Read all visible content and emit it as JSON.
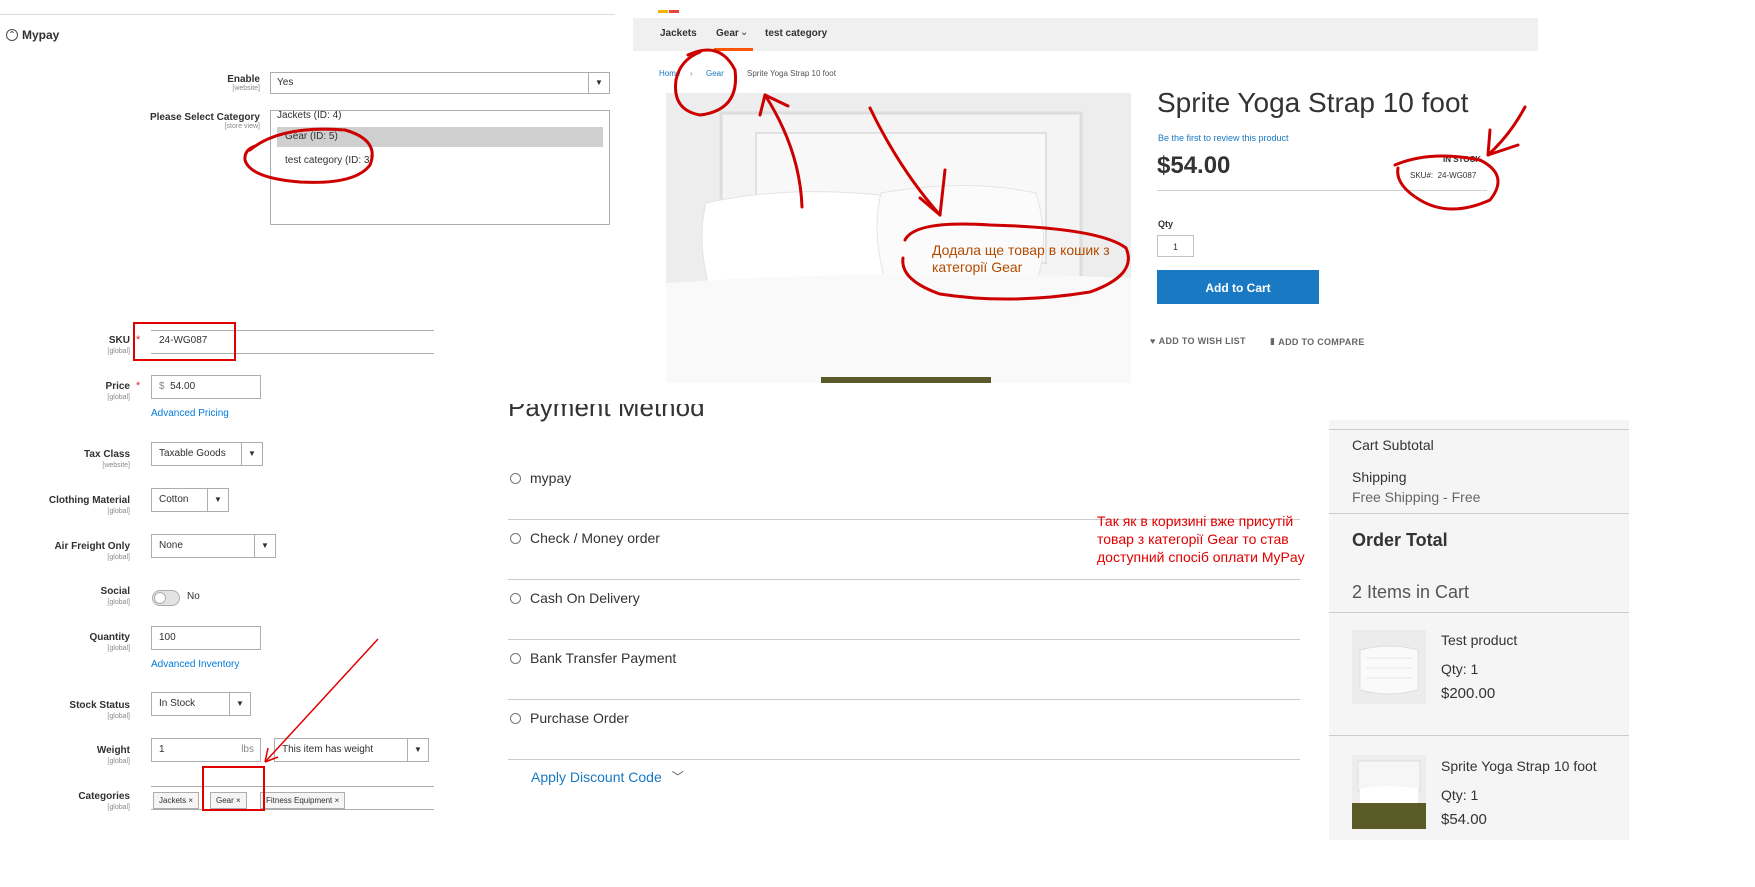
{
  "config": {
    "section_title": "Mypay",
    "enable": {
      "label": "Enable",
      "scope": "[website]",
      "value": "Yes"
    },
    "category": {
      "label": "Please Select Category",
      "scope": "[store view]",
      "options": [
        "Jackets (ID: 4)",
        "Gear (ID: 5)",
        "test category (ID: 3)"
      ],
      "selected_index": 1
    }
  },
  "product_page": {
    "nav": [
      "Jackets",
      "Gear",
      "test category"
    ],
    "breadcrumbs": [
      "Home",
      "Gear",
      "Sprite Yoga Strap 10 foot"
    ],
    "title": "Sprite Yoga Strap 10 foot",
    "review_link": "Be the first to review this product",
    "price": "$54.00",
    "stock": "IN STOCK",
    "sku_label": "SKU#:",
    "sku": "24-WG087",
    "qty_label": "Qty",
    "qty_value": "1",
    "add_to_cart": "Add to Cart",
    "wishlist": "ADD TO WISH LIST",
    "compare": "ADD TO COMPARE"
  },
  "annotations": {
    "bubble": "Додала ще товар в кошик з категорії Gear",
    "note": "Так як в коризині вже присутій товар з категорії Gear то став доступний спосіб оплати MyPay"
  },
  "product_form": {
    "sku": {
      "label": "SKU",
      "scope": "[global]",
      "value": "24-WG087"
    },
    "price": {
      "label": "Price",
      "scope": "[global]",
      "currency": "$",
      "value": "54.00",
      "link": "Advanced Pricing"
    },
    "tax_class": {
      "label": "Tax Class",
      "scope": "[website]",
      "value": "Taxable Goods"
    },
    "clothing_material": {
      "label": "Clothing Material",
      "scope": "[global]",
      "value": "Cotton"
    },
    "air_freight": {
      "label": "Air Freight Only",
      "scope": "[global]",
      "value": "None"
    },
    "social": {
      "label": "Social",
      "scope": "[global]",
      "value": "No"
    },
    "quantity": {
      "label": "Quantity",
      "scope": "[global]",
      "value": "100",
      "link": "Advanced Inventory"
    },
    "stock_status": {
      "label": "Stock Status",
      "scope": "[global]",
      "value": "In Stock"
    },
    "weight": {
      "label": "Weight",
      "scope": "[global]",
      "value": "1",
      "unit": "lbs",
      "has_weight": "This item has weight"
    },
    "categories": {
      "label": "Categories",
      "scope": "[global]",
      "chips": [
        "Jackets",
        "Gear",
        "Fitness Equipment"
      ]
    }
  },
  "payment": {
    "title": "Payment Method",
    "methods": [
      "mypay",
      "Check / Money order",
      "Cash On Delivery",
      "Bank Transfer Payment",
      "Purchase Order"
    ],
    "discount": "Apply Discount Code"
  },
  "summary": {
    "cart_subtotal": "Cart Subtotal",
    "shipping": "Shipping",
    "shipping_method": "Free Shipping - Free",
    "order_total": "Order Total",
    "items_in_cart": "2 Items in Cart",
    "items": [
      {
        "name": "Test product",
        "qty": "Qty: 1",
        "price": "$200.00"
      },
      {
        "name": "Sprite Yoga Strap 10 foot",
        "qty": "Qty: 1",
        "price": "$54.00"
      }
    ]
  },
  "colors": {
    "accent_blue": "#1979c3",
    "annotation_red": "#e00000",
    "nav_orange": "#ff5501"
  }
}
